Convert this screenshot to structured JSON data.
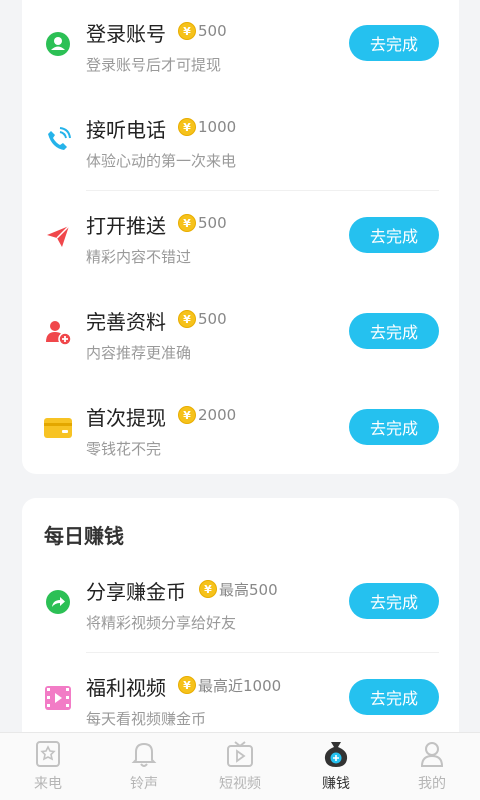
{
  "tasks_card": {
    "items": [
      {
        "title": "登录账号",
        "coin_symbol": "¥",
        "reward": "500",
        "desc": "登录账号后才可提现",
        "button": "去完成",
        "icon": "user-icon",
        "color": "#2cc055"
      },
      {
        "title": "接听电话",
        "coin_symbol": "¥",
        "reward": "1000",
        "desc": "体验心动的第一次来电",
        "button": "",
        "icon": "phone-icon",
        "color": "#25b3ea"
      },
      {
        "title": "打开推送",
        "coin_symbol": "¥",
        "reward": "500",
        "desc": "精彩内容不错过",
        "button": "去完成",
        "icon": "paper-plane-icon",
        "color": "#f0474b"
      },
      {
        "title": "完善资料",
        "coin_symbol": "¥",
        "reward": "500",
        "desc": "内容推荐更准确",
        "button": "去完成",
        "icon": "add-user-icon",
        "color": "#f0474b"
      },
      {
        "title": "首次提现",
        "coin_symbol": "¥",
        "reward": "2000",
        "desc": "零钱花不完",
        "button": "去完成",
        "icon": "card-icon",
        "color": "#f7c324"
      }
    ]
  },
  "daily_card": {
    "title": "每日赚钱",
    "items": [
      {
        "title": "分享赚金币",
        "coin_symbol": "¥",
        "reward": "最高500",
        "desc": "将精彩视频分享给好友",
        "button": "去完成",
        "icon": "share-icon",
        "color": "#2cc055"
      },
      {
        "title": "福利视频",
        "coin_symbol": "¥",
        "reward": "最高近1000",
        "desc": "每天看视频赚金币",
        "button": "去完成",
        "icon": "video-icon",
        "color": "#f27cc6"
      }
    ]
  },
  "tabbar": {
    "tabs": [
      {
        "label": "来电",
        "icon": "caller-card-icon",
        "active": false
      },
      {
        "label": "铃声",
        "icon": "bell-icon",
        "active": false
      },
      {
        "label": "短视频",
        "icon": "tv-icon",
        "active": false
      },
      {
        "label": "赚钱",
        "icon": "money-bag-icon",
        "active": true
      },
      {
        "label": "我的",
        "icon": "profile-icon",
        "active": false
      }
    ]
  },
  "colors": {
    "accent": "#25c1ef",
    "coin": "#f6c21b"
  }
}
